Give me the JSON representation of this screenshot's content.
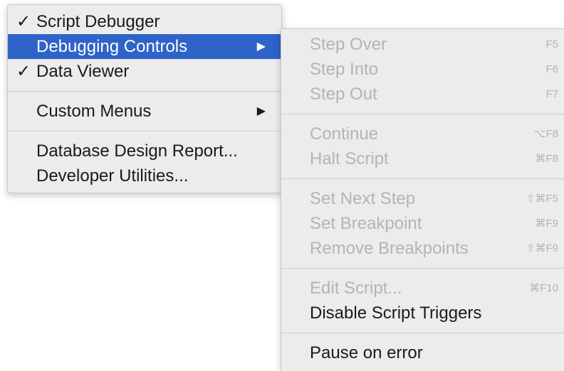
{
  "main_menu": {
    "items": [
      {
        "label": "Script Debugger",
        "check": "✓"
      },
      {
        "label": "Debugging Controls",
        "arrow": "▶"
      },
      {
        "label": "Data Viewer",
        "check": "✓"
      },
      {
        "label": "Custom Menus",
        "arrow": "▶"
      },
      {
        "label": "Database Design Report..."
      },
      {
        "label": "Developer Utilities..."
      }
    ]
  },
  "sub_menu": {
    "items": [
      {
        "label": "Step Over",
        "shortcut": "F5"
      },
      {
        "label": "Step Into",
        "shortcut": "F6"
      },
      {
        "label": "Step Out",
        "shortcut": "F7"
      },
      {
        "label": "Continue",
        "shortcut": "⌥F8"
      },
      {
        "label": "Halt Script",
        "shortcut": "⌘F8"
      },
      {
        "label": "Set Next Step",
        "shortcut": "⇧⌘F5"
      },
      {
        "label": "Set Breakpoint",
        "shortcut": "⌘F9"
      },
      {
        "label": "Remove Breakpoints",
        "shortcut": "⇧⌘F9"
      },
      {
        "label": "Edit Script...",
        "shortcut": "⌘F10"
      },
      {
        "label": "Disable Script Triggers"
      },
      {
        "label": "Pause on error"
      }
    ]
  },
  "colors": {
    "highlight": "#2e63c9",
    "disabled_text": "#b4b4b4",
    "menu_background": "#ececec"
  }
}
